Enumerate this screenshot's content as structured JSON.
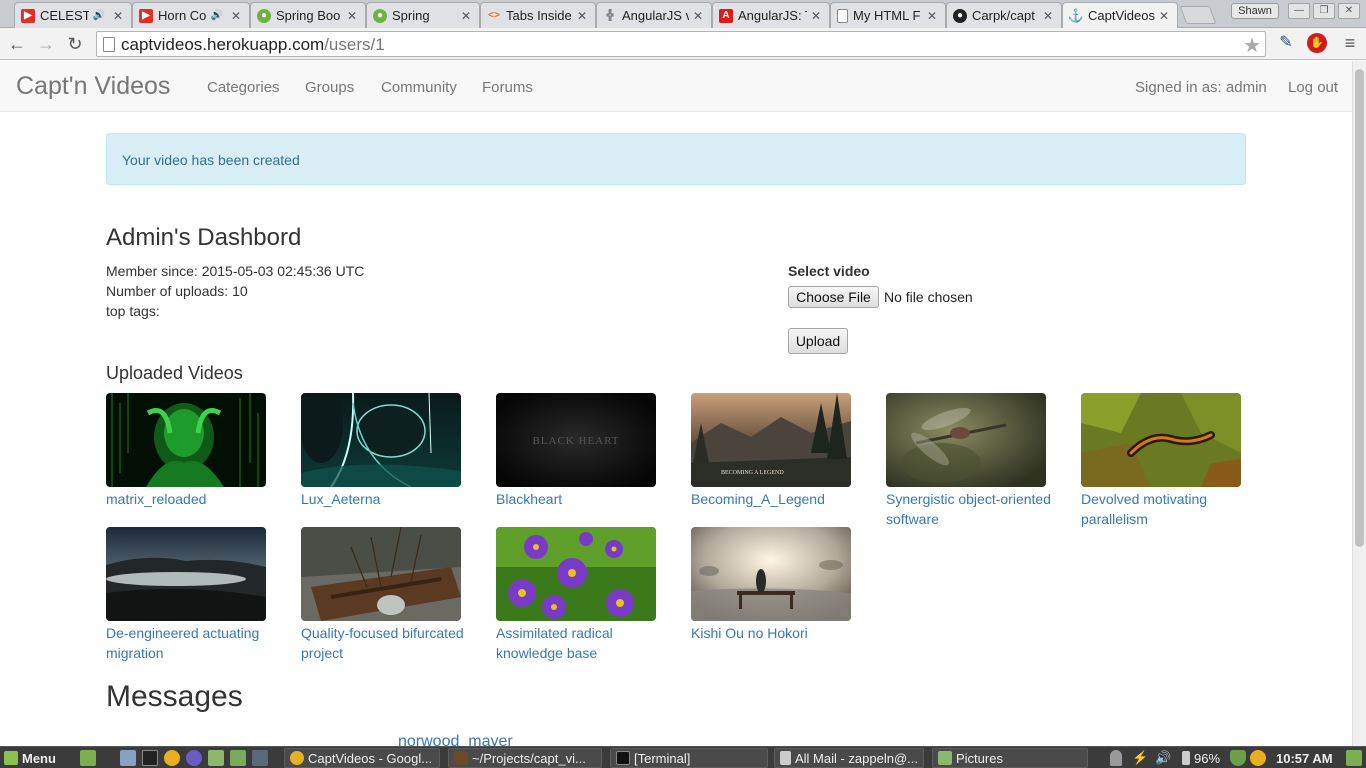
{
  "browser": {
    "tabs": [
      {
        "label": "CELESTI",
        "icon": "youtube-icon",
        "audio": true
      },
      {
        "label": "Horn Co",
        "icon": "youtube-icon",
        "audio": true
      },
      {
        "label": "Spring Boo",
        "icon": "spring-icon",
        "audio": false
      },
      {
        "label": "Spring",
        "icon": "spring-icon",
        "audio": false
      },
      {
        "label": "Tabs Inside",
        "icon": "code-icon",
        "audio": false
      },
      {
        "label": "AngularJS v",
        "icon": "angular-grid-icon",
        "audio": false
      },
      {
        "label": "AngularJS: T",
        "icon": "angular-icon",
        "audio": false
      },
      {
        "label": "My HTML F",
        "icon": "page-icon",
        "audio": false
      },
      {
        "label": "Carpk/capt",
        "icon": "github-icon",
        "audio": false
      },
      {
        "label": "CaptVideos",
        "icon": "anchor-icon",
        "audio": false
      }
    ],
    "profile_name": "Shawn",
    "url_host": "captvideos.herokuapp.com",
    "url_path": "/users/1"
  },
  "site": {
    "brand": "Capt'n Videos",
    "nav": [
      "Categories",
      "Groups",
      "Community",
      "Forums"
    ],
    "signed_in": "Signed in as: admin",
    "logout": "Log out"
  },
  "alert": "Your video has been created",
  "dashboard": {
    "title": "Admin's Dashbord",
    "member_since": "Member since: 2015-05-03 02:45:36 UTC",
    "uploads": "Number of uploads: 10",
    "top_tags": "top tags:"
  },
  "upload_form": {
    "label": "Select video",
    "choose_button": "Choose File",
    "no_file": "No file chosen",
    "upload_button": "Upload"
  },
  "uploaded_heading": "Uploaded Videos",
  "videos": [
    {
      "title": "matrix_reloaded"
    },
    {
      "title": "Lux_Aeterna"
    },
    {
      "title": "Blackheart"
    },
    {
      "title": "Becoming_A_Legend"
    },
    {
      "title": "Synergistic object-oriented software"
    },
    {
      "title": "Devolved motivating parallelism"
    },
    {
      "title": "De-engineered actuating migration"
    },
    {
      "title": "Quality-focused bifurcated project"
    },
    {
      "title": "Assimilated radical knowledge base"
    },
    {
      "title": "Kishi Ou no Hokori"
    }
  ],
  "thumb_text": {
    "blackheart": "BLACK HEART",
    "legend": "BECOMING A LEGEND"
  },
  "messages_heading": "Messages",
  "message_user": "norwood_mayer",
  "taskbar": {
    "menu": "Menu",
    "windows": [
      "CaptVideos - Googl...",
      "~/Projects/capt_vi...",
      "[Terminal]",
      "All Mail - zappeln@...",
      "Pictures"
    ],
    "battery": "96%",
    "clock": "10:57 AM"
  }
}
